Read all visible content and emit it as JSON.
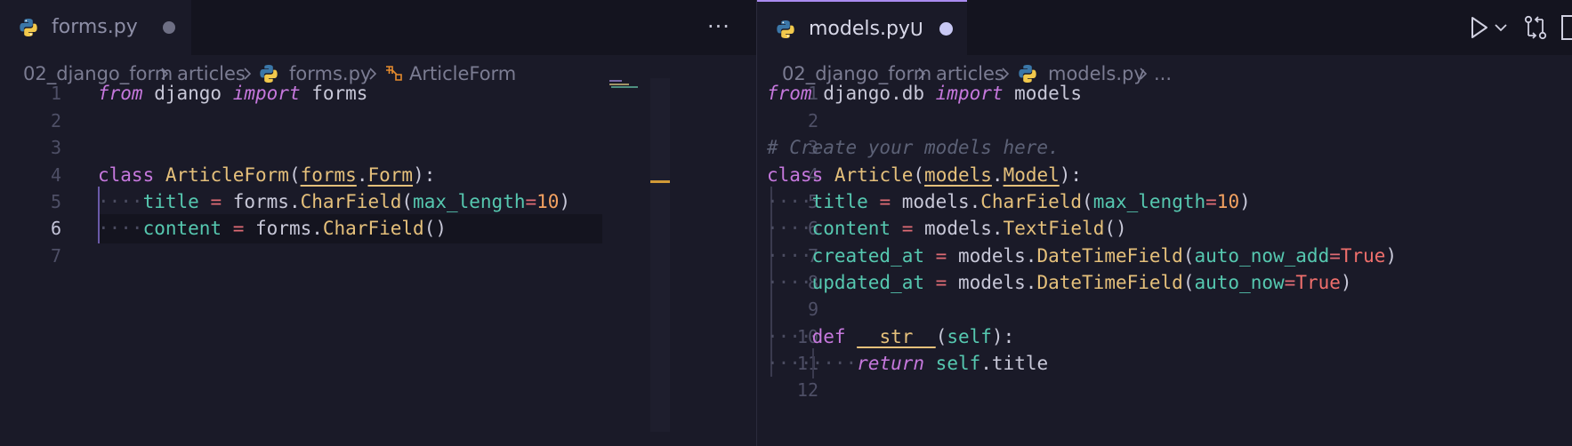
{
  "left": {
    "tab": {
      "label": "forms.py",
      "icon": "python-icon"
    },
    "breadcrumb": {
      "folder": "02_django_form",
      "subfolder": "articles",
      "file": "forms.py",
      "symbol": "ArticleForm"
    },
    "lines": [
      "1",
      "2",
      "3",
      "4",
      "5",
      "6",
      "7"
    ],
    "code": {
      "l1": [
        "from",
        " django ",
        "import",
        " forms"
      ],
      "l4": [
        "class",
        " ",
        "ArticleForm",
        "(",
        "forms",
        ".",
        "Form",
        "):"
      ],
      "l5": [
        "title",
        " = ",
        "forms.",
        "CharField",
        "(",
        "max_length",
        "=",
        "10",
        ")"
      ],
      "l6": [
        "content",
        " = ",
        "forms.",
        "CharField",
        "()"
      ]
    }
  },
  "right": {
    "tab": {
      "label": "models.py",
      "git_status": "U",
      "icon": "python-icon"
    },
    "breadcrumb": {
      "folder": "02_django_form",
      "subfolder": "articles",
      "file": "models.py",
      "ellipsis": "..."
    },
    "lines": [
      "1",
      "2",
      "3",
      "4",
      "5",
      "6",
      "7",
      "8",
      "9",
      "10",
      "11",
      "12"
    ],
    "code": {
      "l1": [
        "from",
        " django.db ",
        "import",
        " models"
      ],
      "l3": "# Create your models here.",
      "l4": [
        "class",
        " ",
        "Article",
        "(",
        "models",
        ".",
        "Model",
        "):"
      ],
      "l5": [
        "title",
        " = ",
        "models.",
        "CharField",
        "(",
        "max_length",
        "=",
        "10",
        ")"
      ],
      "l6": [
        "content",
        " = ",
        "models.",
        "TextField",
        "()"
      ],
      "l7": [
        "created_at",
        " = ",
        "models.",
        "DateTimeField",
        "(",
        "auto_now_add",
        "=",
        "True",
        ")"
      ],
      "l8": [
        "updated_at",
        " = ",
        "models.",
        "DateTimeField",
        "(",
        "auto_now",
        "=",
        "True",
        ")"
      ],
      "l10": [
        "def",
        " ",
        "__str__",
        "(",
        "self",
        "):"
      ],
      "l11": [
        "return",
        " ",
        "self",
        ".",
        "title"
      ]
    }
  },
  "toolbar": {
    "more": "···"
  },
  "colors": {
    "accent": "#a98bf0",
    "keyword": "#c678dd",
    "class": "#e5c07b",
    "attribute": "#56c8b0",
    "operator": "#e06c75",
    "number": "#f4a261"
  }
}
